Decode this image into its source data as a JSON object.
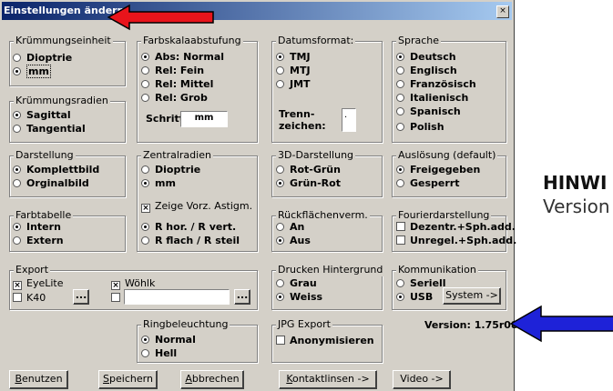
{
  "window": {
    "title": "Einstellungen ändern:",
    "close_label": "×"
  },
  "groups": {
    "kruemmungseinheit": {
      "label": "Krümmungseinheit",
      "options": [
        "Dioptrie",
        "mm"
      ]
    },
    "kruemmungsradien": {
      "label": "Krümmungsradien",
      "options": [
        "Sagittal",
        "Tangential"
      ]
    },
    "farbskala": {
      "label": "Farbskalaabstufung",
      "options": [
        "Abs: Normal",
        "Rel: Fein",
        "Rel: Mittel",
        "Rel: Grob"
      ],
      "schritt_label": "Schritt:",
      "schritt_value": "mm"
    },
    "datumsformat": {
      "label": "Datumsformat:",
      "options": [
        "TMJ",
        "MTJ",
        "JMT"
      ],
      "trenn_label": "Trenn-",
      "zeichen_label": "zeichen:",
      "trenn_value": "."
    },
    "sprache": {
      "label": "Sprache",
      "options": [
        "Deutsch",
        "Englisch",
        "Französisch",
        "Italienisch",
        "Spanisch",
        "Polish"
      ]
    },
    "darstellung": {
      "label": "Darstellung",
      "options": [
        "Komplettbild",
        "Orginalbild"
      ]
    },
    "zentralradien": {
      "label": "Zentralradien",
      "options": [
        "Dioptrie",
        "mm"
      ],
      "checkbox": "Zeige Vorz. Astigm.",
      "options2": [
        "R hor. / R vert.",
        "R flach / R steil"
      ]
    },
    "darstellung3d": {
      "label": "3D-Darstellung",
      "options": [
        "Rot-Grün",
        "Grün-Rot"
      ]
    },
    "ausloesung": {
      "label": "Auslösung (default)",
      "options": [
        "Freigegeben",
        "Gesperrt"
      ]
    },
    "farbtabelle": {
      "label": "Farbtabelle",
      "options": [
        "Intern",
        "Extern"
      ]
    },
    "rueckflaechen": {
      "label": "Rückflächenverm.",
      "options": [
        "An",
        "Aus"
      ]
    },
    "fourier": {
      "label": "Fourierdarstellung",
      "options": [
        "Dezentr.+Sph.add.",
        "Unregel.+Sph.add."
      ]
    },
    "export": {
      "label": "Export",
      "items": [
        "EyeLite",
        "Wöhlk",
        "K40"
      ],
      "browse": "..."
    },
    "drucken": {
      "label": "Drucken Hintergrund",
      "options": [
        "Grau",
        "Weiss"
      ]
    },
    "kommunikation": {
      "label": "Kommunikation",
      "options": [
        "Seriell",
        "USB"
      ],
      "system_button": "System ->"
    },
    "ringbeleuchtung": {
      "label": "Ringbeleuchtung",
      "options": [
        "Normal",
        "Hell"
      ]
    },
    "jpg": {
      "label": "JPG Export",
      "checkbox": "Anonymisieren"
    }
  },
  "version": "Version: 1.75r08H",
  "buttons": {
    "benutzen": {
      "accel": "B",
      "rest": "enutzen"
    },
    "speichern": {
      "accel": "S",
      "rest": "peichern"
    },
    "abbrechen": {
      "accel": "A",
      "rest": "bbrechen"
    },
    "kontakt": {
      "accel": "K",
      "rest": "ontaktlinsen ->"
    },
    "video": "Video ->"
  },
  "outside": {
    "heading": "HINWI",
    "line": "Version"
  },
  "colors": {
    "arrow_red": "#e8141b",
    "arrow_blue": "#1e22d8",
    "title_bar": "#0a246a"
  }
}
